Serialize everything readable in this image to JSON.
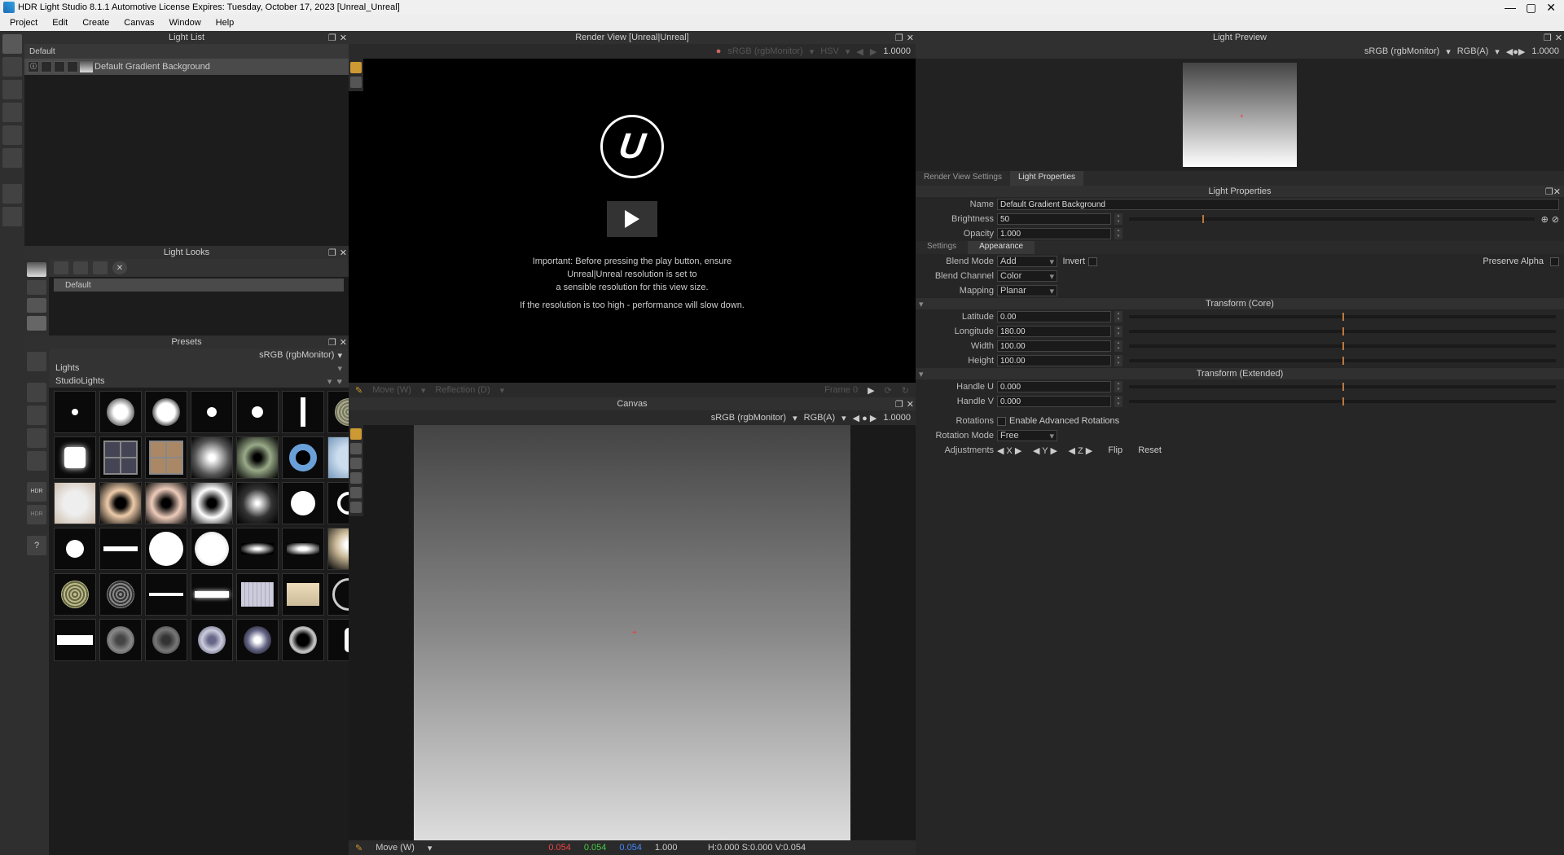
{
  "title": "HDR Light Studio 8.1.1   Automotive License Expires: Tuesday, October 17, 2023   [Unreal_Unreal]",
  "menu": [
    "Project",
    "Edit",
    "Create",
    "Canvas",
    "Window",
    "Help"
  ],
  "panels": {
    "light_list": {
      "title": "Light List",
      "group": "Default",
      "item": "Default Gradient Background"
    },
    "light_looks": {
      "title": "Light Looks",
      "item": "Default"
    },
    "presets": {
      "title": "Presets",
      "colorspace": "sRGB (rgbMonitor)",
      "cat": "Lights",
      "sub": "StudioLights"
    },
    "render_view": {
      "title": "Render View [Unreal|Unreal]",
      "colorspace": "sRGB (rgbMonitor)",
      "channel": "HSV",
      "exposure": "1.0000",
      "msg1": "Important: Before pressing the play button, ensure",
      "msg2": "Unreal|Unreal resolution is set to",
      "msg3": "a sensible resolution for this view size.",
      "msg4": "If the resolution is too high - performance will slow down.",
      "tool_move": "Move (W)",
      "tool_refl": "Reflection (D)",
      "frame": "Frame 0"
    },
    "canvas": {
      "title": "Canvas",
      "colorspace": "sRGB (rgbMonitor)",
      "channel": "RGB(A)",
      "exposure": "1.0000",
      "tool": "Move (W)",
      "status_r": "0.054",
      "status_g": "0.054",
      "status_b": "0.054",
      "status_a": "1.000",
      "hsv": "H:0.000 S:0.000 V:0.054"
    },
    "light_preview": {
      "title": "Light Preview",
      "colorspace": "sRGB (rgbMonitor)",
      "channel": "RGB(A)",
      "exposure": "1.0000"
    },
    "tabs": {
      "rvs": "Render View Settings",
      "lp": "Light Properties"
    },
    "props": {
      "title": "Light Properties",
      "name_l": "Name",
      "name_v": "Default Gradient Background",
      "bright_l": "Brightness",
      "bright_v": "50",
      "opac_l": "Opacity",
      "opac_v": "1.000",
      "settings": "Settings",
      "appearance": "Appearance",
      "blend_l": "Blend Mode",
      "blend_v": "Add",
      "invert_l": "Invert",
      "preserve_l": "Preserve Alpha",
      "bchan_l": "Blend Channel",
      "bchan_v": "Color",
      "map_l": "Mapping",
      "map_v": "Planar",
      "tcore": "Transform (Core)",
      "lat_l": "Latitude",
      "lat_v": "0.00",
      "lon_l": "Longitude",
      "lon_v": "180.00",
      "w_l": "Width",
      "w_v": "100.00",
      "h_l": "Height",
      "h_v": "100.00",
      "text": "Transform (Extended)",
      "hu_l": "Handle U",
      "hu_v": "0.000",
      "hv_l": "Handle V",
      "hv_v": "0.000",
      "rot_l": "Rotations",
      "rot_chk": "Enable Advanced Rotations",
      "rmode_l": "Rotation Mode",
      "rmode_v": "Free",
      "adj_l": "Adjustments",
      "flip": "Flip",
      "reset": "Reset"
    }
  }
}
